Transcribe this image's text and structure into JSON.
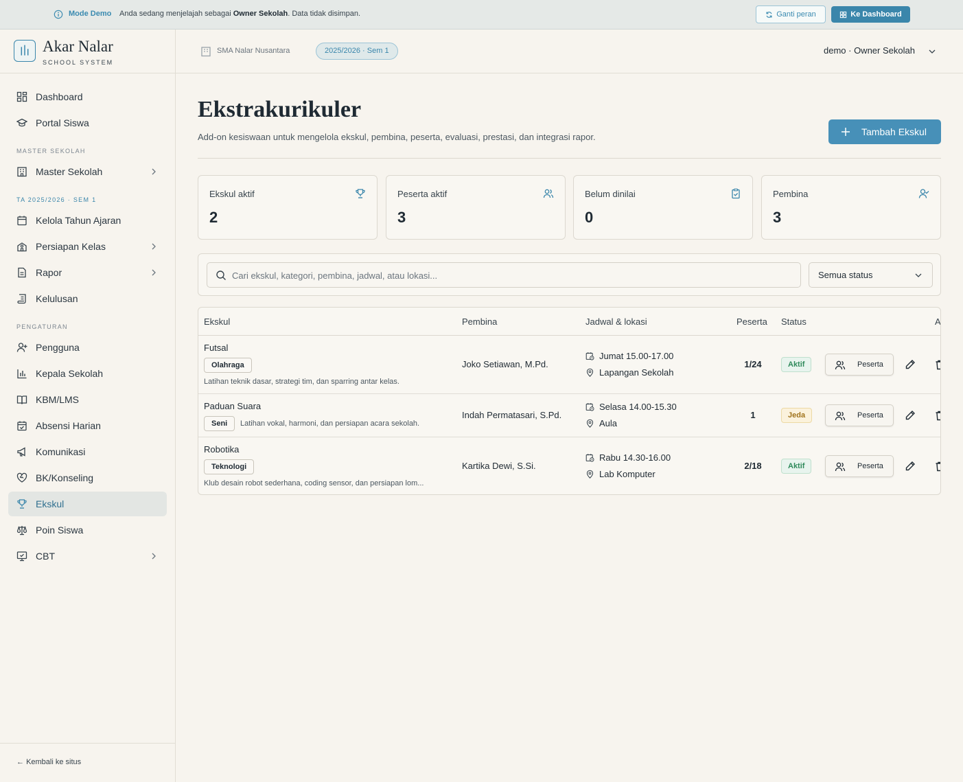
{
  "banner": {
    "mode": "Mode Demo",
    "message_pre": "Anda sedang menjelajah sebagai ",
    "message_role": "Owner Sekolah",
    "message_post": ". Data tidak disimpan.",
    "ganti_label": "Ganti peran",
    "dashboard_label": "Ke Dashboard"
  },
  "brand": {
    "name": "Akar Nalar",
    "subtitle": "SCHOOL SYSTEM"
  },
  "sidebar": {
    "items_top": [
      {
        "label": "Dashboard",
        "icon": "dashboard-icon"
      },
      {
        "label": "Portal Siswa",
        "icon": "graduation-cap-icon"
      }
    ],
    "section_master": "MASTER SEKOLAH",
    "master_item": {
      "label": "Master Sekolah",
      "icon": "building-icon"
    },
    "section_term": "TA 2025/2026 · SEM 1",
    "term_items": [
      {
        "label": "Kelola Tahun Ajaran",
        "icon": "calendar-icon"
      },
      {
        "label": "Persiapan Kelas",
        "icon": "school-icon"
      },
      {
        "label": "Rapor",
        "icon": "document-icon"
      },
      {
        "label": "Kelulusan",
        "icon": "scroll-icon"
      }
    ],
    "section_settings": "PENGATURAN",
    "settings_items": [
      {
        "label": "Pengguna",
        "icon": "user-plus-icon"
      },
      {
        "label": "Kepala Sekolah",
        "icon": "bar-chart-icon"
      },
      {
        "label": "KBM/LMS",
        "icon": "book-icon"
      },
      {
        "label": "Absensi Harian",
        "icon": "calendar-check-icon"
      },
      {
        "label": "Komunikasi",
        "icon": "megaphone-icon"
      },
      {
        "label": "BK/Konseling",
        "icon": "heart-handshake-icon"
      },
      {
        "label": "Ekskul",
        "icon": "trophy-icon"
      },
      {
        "label": "Poin Siswa",
        "icon": "scale-icon"
      },
      {
        "label": "CBT",
        "icon": "monitor-check-icon"
      }
    ],
    "back_label": "Kembali ke situs"
  },
  "topbar": {
    "school": "SMA Nalar Nusantara",
    "term": "2025/2026 · Sem 1",
    "user": "demo · Owner Sekolah"
  },
  "page": {
    "title": "Ekstrakurikuler",
    "subtitle": "Add-on kesiswaan untuk mengelola ekskul, pembina, peserta, evaluasi, prestasi, dan integrasi rapor.",
    "add_button": "Tambah Ekskul"
  },
  "stats": [
    {
      "label": "Ekskul aktif",
      "value": "2",
      "icon": "trophy-icon"
    },
    {
      "label": "Peserta aktif",
      "value": "3",
      "icon": "users-icon"
    },
    {
      "label": "Belum dinilai",
      "value": "0",
      "icon": "clipboard-check-icon"
    },
    {
      "label": "Pembina",
      "value": "3",
      "icon": "user-check-icon"
    }
  ],
  "filters": {
    "search_placeholder": "Cari ekskul, kategori, pembina, jadwal, atau lokasi...",
    "status_selected": "Semua status"
  },
  "table": {
    "headers": [
      "Ekskul",
      "Pembina",
      "Jadwal & lokasi",
      "Peserta",
      "Status",
      "A"
    ],
    "rows": [
      {
        "name": "Futsal",
        "category": "Olahraga",
        "description": "Latihan teknik dasar, strategi tim, dan sparring antar kelas.",
        "pembina": "Joko Setiawan, M.Pd.",
        "schedule": "Jumat 15.00-17.00",
        "location": "Lapangan Sekolah",
        "peserta": "1/24",
        "status": "Aktif",
        "action_label": "Peserta"
      },
      {
        "name": "Paduan Suara",
        "category": "Seni",
        "description": "Latihan vokal, harmoni, dan persiapan acara sekolah.",
        "pembina": "Indah Permatasari, S.Pd.",
        "schedule": "Selasa 14.00-15.30",
        "location": "Aula",
        "peserta": "1",
        "status": "Jeda",
        "action_label": "Peserta"
      },
      {
        "name": "Robotika",
        "category": "Teknologi",
        "description": "Klub desain robot sederhana, coding sensor, dan persiapan lom...",
        "pembina": "Kartika Dewi, S.Si.",
        "schedule": "Rabu 14.30-16.00",
        "location": "Lab Komputer",
        "peserta": "2/18",
        "status": "Aktif",
        "action_label": "Peserta"
      }
    ]
  },
  "colors": {
    "accent": "#3a86ab",
    "background": "#f7f4ee",
    "active_nav": "#e3e6e3",
    "status_active": "#2f8a5b",
    "status_paused": "#a0731b"
  }
}
